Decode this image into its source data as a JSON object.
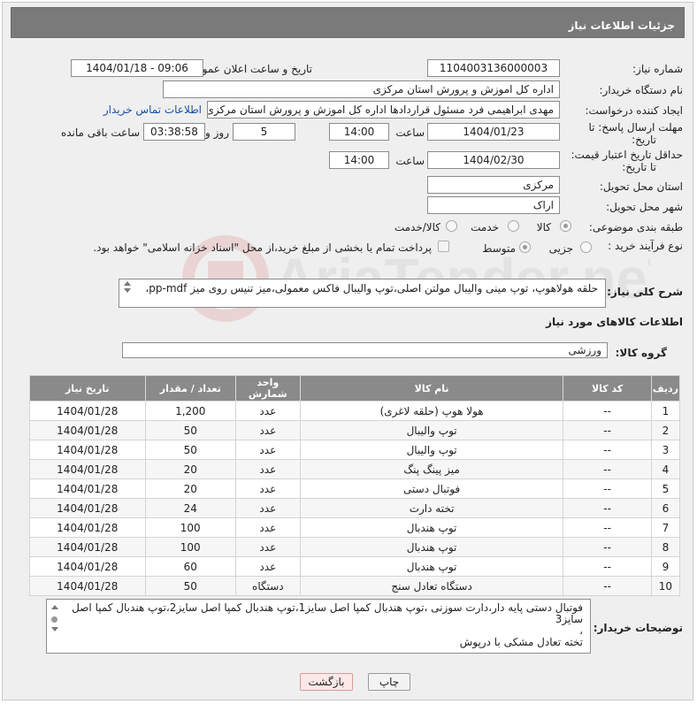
{
  "header": {
    "title": "جزئیات اطلاعات نیاز"
  },
  "fields": {
    "need_number_label": "شماره نیاز:",
    "need_number": "1104003136000003",
    "announce_label": "تاریخ و ساعت اعلان عمومی:",
    "announce_value": "1404/01/18 - 09:06",
    "buyer_org_label": "نام دستگاه خریدار:",
    "buyer_org": "اداره کل اموزش و پرورش استان مرکزی",
    "creator_label": "ایجاد کننده درخواست:",
    "creator": "مهدی ابراهیمی فرد مسئول قراردادها اداره کل اموزش و پرورش استان مرکزی",
    "contact_link": "اطلاعات تماس خریدار",
    "reply_deadline_label_1": "مهلت ارسال پاسخ: تا",
    "reply_deadline_label_2": "تاریخ:",
    "reply_date": "1404/01/23",
    "time_label": "ساعت",
    "reply_time": "14:00",
    "days_value": "5",
    "days_label": "روز و",
    "remaining_time": "03:38:58",
    "remaining_label": "ساعت باقی مانده",
    "price_deadline_label_1": "حداقل تاریخ اعتبار قیمت:",
    "price_deadline_label_2": "تا تاریخ:",
    "price_date": "1404/02/30",
    "price_time": "14:00",
    "province_label": "استان محل تحویل:",
    "province": "مرکزی",
    "city_label": "شهر محل تحویل:",
    "city": "اراک",
    "category_label": "طبقه بندی موضوعی:",
    "category_options": [
      "کالا",
      "خدمت",
      "کالا/خدمت"
    ],
    "process_label": "نوع فرآیند خرید :",
    "process_options": [
      "جزیی",
      "متوسط"
    ],
    "payment_note": "پرداخت تمام یا بخشی از مبلغ خرید،از محل \"اسناد خزانه اسلامی\" خواهد بود."
  },
  "summary": {
    "label": "شرح کلی نیاز:",
    "text": "حلقه هولاهوپ، توپ مینی والیبال مولتن اصلی،توپ والیبال  فاکس معمولی،میز تنیس روی میز  pp-mdf،"
  },
  "goods": {
    "section_title": "اطلاعات کالاهای مورد نیاز",
    "group_label": "گروه کالا:",
    "group_value": "ورزشی",
    "columns": [
      "ردیف",
      "کد کالا",
      "نام کالا",
      "واحد شمارش",
      "تعداد / مقدار",
      "تاریخ نیاز"
    ],
    "rows": [
      {
        "idx": "1",
        "code": "--",
        "name": "هولا هوپ (حلقه لاغری)",
        "unit": "عدد",
        "qty": "1,200",
        "date": "1404/01/28"
      },
      {
        "idx": "2",
        "code": "--",
        "name": "توپ والیبال",
        "unit": "عدد",
        "qty": "50",
        "date": "1404/01/28"
      },
      {
        "idx": "3",
        "code": "--",
        "name": "توپ والیبال",
        "unit": "عدد",
        "qty": "50",
        "date": "1404/01/28"
      },
      {
        "idx": "4",
        "code": "--",
        "name": "میز پینگ پنگ",
        "unit": "عدد",
        "qty": "20",
        "date": "1404/01/28"
      },
      {
        "idx": "5",
        "code": "--",
        "name": "فوتبال دستی",
        "unit": "عدد",
        "qty": "20",
        "date": "1404/01/28"
      },
      {
        "idx": "6",
        "code": "--",
        "name": "تخته دارت",
        "unit": "عدد",
        "qty": "24",
        "date": "1404/01/28"
      },
      {
        "idx": "7",
        "code": "--",
        "name": "توپ هندبال",
        "unit": "عدد",
        "qty": "100",
        "date": "1404/01/28"
      },
      {
        "idx": "8",
        "code": "--",
        "name": "توپ هندبال",
        "unit": "عدد",
        "qty": "100",
        "date": "1404/01/28"
      },
      {
        "idx": "9",
        "code": "--",
        "name": "توپ هندبال",
        "unit": "عدد",
        "qty": "60",
        "date": "1404/01/28"
      },
      {
        "idx": "10",
        "code": "--",
        "name": "دستگاه تعادل سنج",
        "unit": "دستگاه",
        "qty": "50",
        "date": "1404/01/28"
      }
    ]
  },
  "buyer_notes": {
    "label": "توضیحات خریدار:",
    "line1": "فوتبال دستی پایه دار،دارت سوزنی ،توپ هندبال کمپا اصل سایز1،توپ هندبال کمپا اصل سایز2،توپ هندبال کمپا اصل",
    "line2": "سایز3",
    "line3": "،",
    "line4": "تخته تعادل مشکی با درپوش"
  },
  "buttons": {
    "print": "چاپ",
    "back": "بازگشت"
  },
  "watermark": {
    "text": "AriaTender.neT"
  }
}
